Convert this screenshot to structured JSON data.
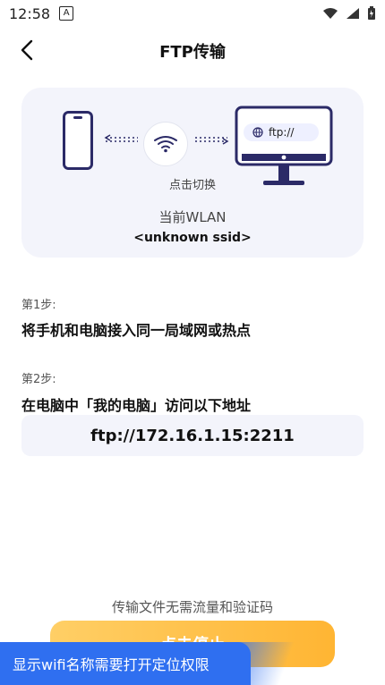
{
  "status_bar": {
    "time": "12:58",
    "left_icon": "notification-a-icon",
    "right_icons": [
      "wifi-signal-icon",
      "cellular-signal-icon",
      "battery-charging-icon"
    ]
  },
  "header": {
    "title": "FTP传输",
    "back_icon": "chevron-left-icon"
  },
  "card": {
    "switch_label": "点击切换",
    "wlan_label": "当前WLAN",
    "ssid": "<unknown ssid>",
    "ftp_chip_text": "ftp://",
    "icons": {
      "phone": "phone-icon",
      "wifi": "wifi-icon",
      "monitor": "monitor-icon",
      "globe": "globe-icon",
      "arrows": "dotted-arrow-icon"
    },
    "colors": {
      "accent": "#2b2a67",
      "background": "#f3f4fb"
    }
  },
  "steps": [
    {
      "label": "第1步:",
      "text": "将手机和电脑接入同一局域网或热点"
    },
    {
      "label": "第2步:",
      "text": "在电脑中「我的电脑」访问以下地址"
    }
  ],
  "ftp_address": "ftp://172.16.1.15:2211",
  "note": "传输文件无需流量和验证码",
  "bottom_button": {
    "label": "点击停止",
    "color_start": "#ffcf66",
    "color_end": "#ffb533"
  },
  "location_banner": {
    "text": "显示wifi名称需要打开定位权限",
    "color": "#2f6ff0"
  }
}
